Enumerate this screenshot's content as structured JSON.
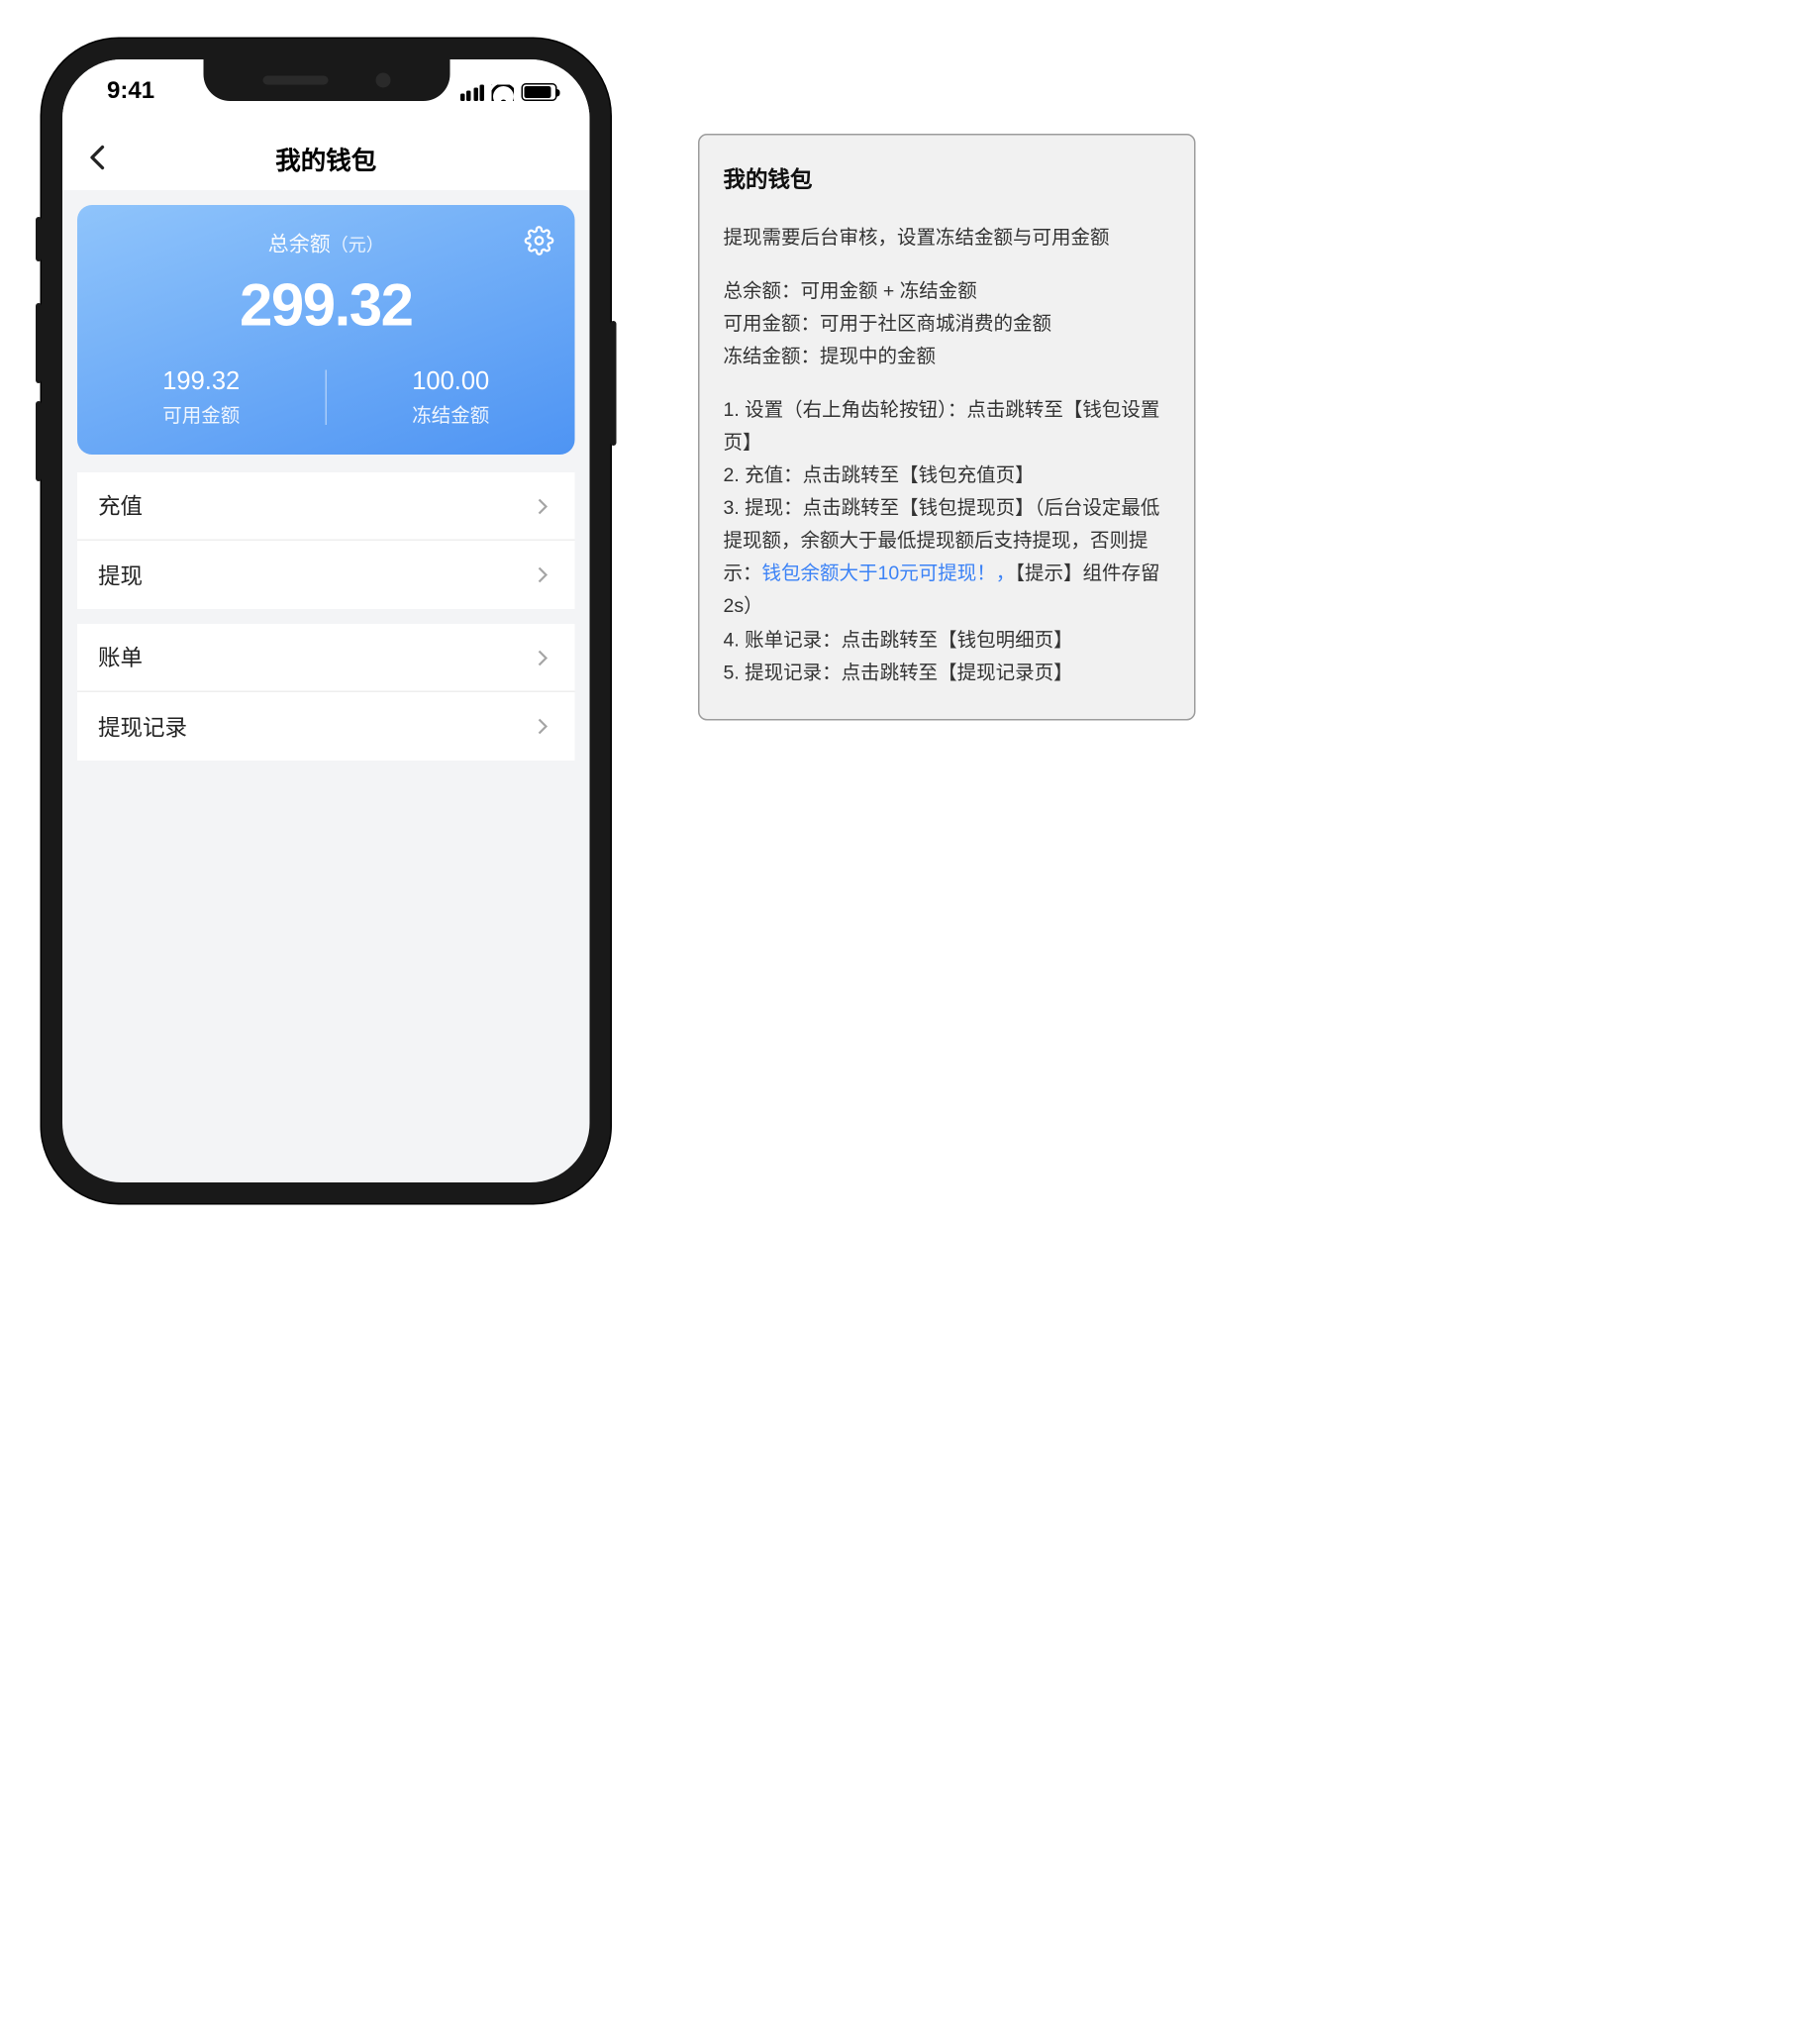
{
  "statusbar": {
    "time": "9:41"
  },
  "nav": {
    "title": "我的钱包"
  },
  "balance": {
    "total_label": "总余额",
    "total_unit": "（元）",
    "total_amount": "299.32",
    "available_value": "199.32",
    "available_label": "可用金额",
    "frozen_value": "100.00",
    "frozen_label": "冻结金额"
  },
  "menu": {
    "g1": {
      "i0": "充值",
      "i1": "提现"
    },
    "g2": {
      "i0": "账单",
      "i1": "提现记录"
    }
  },
  "spec": {
    "title": "我的钱包",
    "p1": "提现需要后台审核，设置冻结金额与可用金额",
    "p2a": "总余额：可用金额 + 冻结金额",
    "p2b": "可用金额：可用于社区商城消费的金额",
    "p2c": "冻结金额：提现中的金额",
    "l1": "1. 设置（右上角齿轮按钮）：点击跳转至【钱包设置页】",
    "l2": "2. 充值：点击跳转至【钱包充值页】",
    "l3a": "3. 提现：点击跳转至【钱包提现页】（后台设定最低提现额，余额大于最低提现额后支持提现，否则提示：",
    "l3blue": "钱包余额大于10元可提现！，",
    "l3b": "【提示】组件存留2s）",
    "l4": "4. 账单记录：点击跳转至【钱包明细页】",
    "l5": "5. 提现记录：点击跳转至【提现记录页】"
  }
}
